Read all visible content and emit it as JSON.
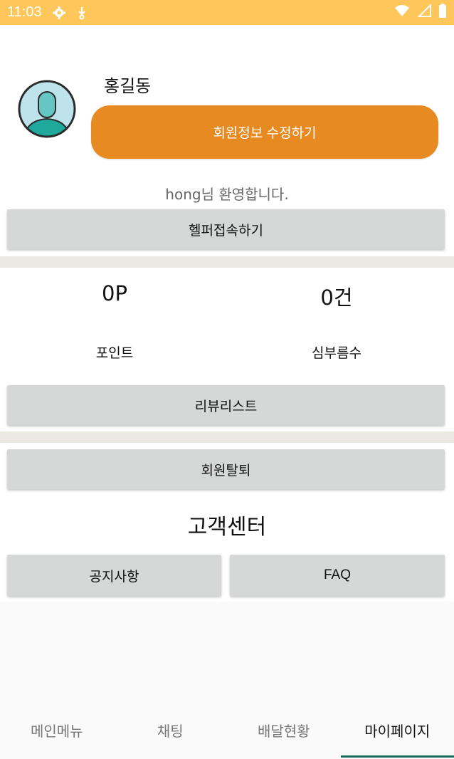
{
  "status_bar": {
    "time": "11:03",
    "icons_left": [
      "gear-icon",
      "download-icon"
    ],
    "icons_right": [
      "wifi-icon",
      "signal-icon",
      "battery-icon"
    ],
    "color": "#ffc65a"
  },
  "profile": {
    "name": "홍길동",
    "edit_button_label": "회원정보 수정하기",
    "welcome_text": "hong님 환영합니다.",
    "helper_button_label": "헬퍼접속하기"
  },
  "stats": {
    "points_value": "0P",
    "points_label": "포인트",
    "errands_value": "0건",
    "errands_label": "심부름수"
  },
  "review_button_label": "리뷰리스트",
  "withdraw_button_label": "회원탈퇴",
  "customer_center": {
    "title": "고객센터",
    "notice_label": "공지사항",
    "faq_label": "FAQ"
  },
  "bottom_nav": {
    "items": [
      {
        "label": "메인메뉴"
      },
      {
        "label": "채팅"
      },
      {
        "label": "배달현황"
      },
      {
        "label": "마이페이지"
      }
    ],
    "active_index": 3,
    "accent_color": "#1a6b5c"
  },
  "accent_color": "#e88a22"
}
